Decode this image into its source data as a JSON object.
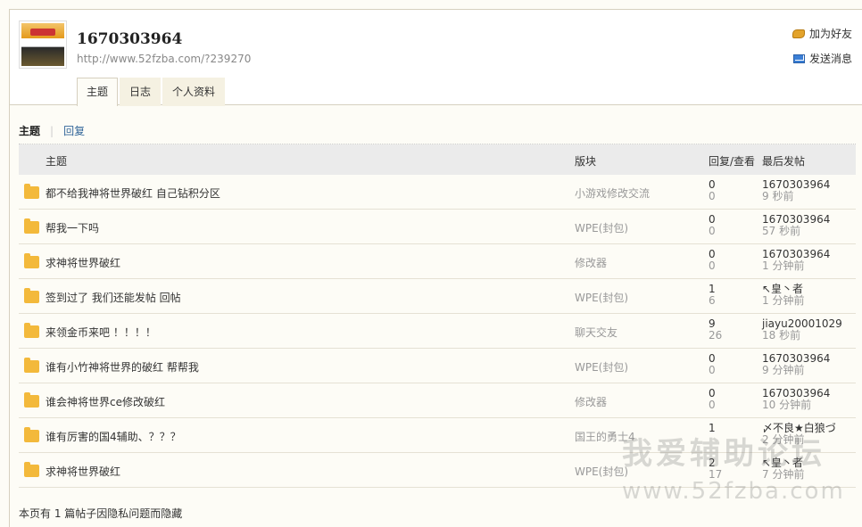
{
  "profile": {
    "username": "1670303964",
    "url": "http://www.52fzba.com/?239270",
    "avatar_icon": "user-avatar",
    "actions": [
      {
        "label": "加为好友",
        "icon": "handshake-icon"
      },
      {
        "label": "发送消息",
        "icon": "envelope-icon"
      }
    ]
  },
  "tabs": [
    {
      "label": "主题",
      "active": true
    },
    {
      "label": "日志",
      "active": false
    },
    {
      "label": "个人资料",
      "active": false
    }
  ],
  "subtabs": {
    "active": "主题",
    "other": "回复"
  },
  "table": {
    "headers": {
      "subject": "主题",
      "forum": "版块",
      "replies_views": "回复/查看",
      "last_post": "最后发帖"
    },
    "rows": [
      {
        "title": "都不给我神将世界破红 自己钻积分区",
        "forum": "小游戏修改交流",
        "replies": "0",
        "views": "0",
        "last_user": "1670303964",
        "last_time": "9 秒前"
      },
      {
        "title": "帮我一下吗",
        "forum": "WPE(封包)",
        "replies": "0",
        "views": "0",
        "last_user": "1670303964",
        "last_time": "57 秒前"
      },
      {
        "title": "求神将世界破红",
        "forum": "修改器",
        "replies": "0",
        "views": "0",
        "last_user": "1670303964",
        "last_time": "1 分钟前"
      },
      {
        "title": "签到过了 我们还能发帖 回帖",
        "forum": "WPE(封包)",
        "replies": "1",
        "views": "6",
        "last_user": "↖皇丶者",
        "last_time": "1 分钟前"
      },
      {
        "title": "来领金币来吧 ！！！！",
        "forum": "聊天交友",
        "replies": "9",
        "views": "26",
        "last_user": "jiayu20001029",
        "last_time": "18 秒前"
      },
      {
        "title": "谁有小竹神将世界的破红 帮帮我",
        "forum": "WPE(封包)",
        "replies": "0",
        "views": "0",
        "last_user": "1670303964",
        "last_time": "9 分钟前"
      },
      {
        "title": "谁会神将世界ce修改破红",
        "forum": "修改器",
        "replies": "0",
        "views": "0",
        "last_user": "1670303964",
        "last_time": "10 分钟前"
      },
      {
        "title": "谁有厉害的国4辅助、？？？",
        "forum": "国王的勇士4",
        "replies": "1",
        "views": "",
        "last_user": "〆不良★白狼づ",
        "last_time": "2 分钟前"
      },
      {
        "title": "求神将世界破红",
        "forum": "WPE(封包)",
        "replies": "2",
        "views": "17",
        "last_user": "↖皇丶者",
        "last_time": "7 分钟前"
      }
    ]
  },
  "footer_note": "本页有 1 篇帖子因隐私问题而隐藏",
  "watermark": {
    "line1": "我爱辅助论坛",
    "line2": "www.52fzba.com"
  }
}
